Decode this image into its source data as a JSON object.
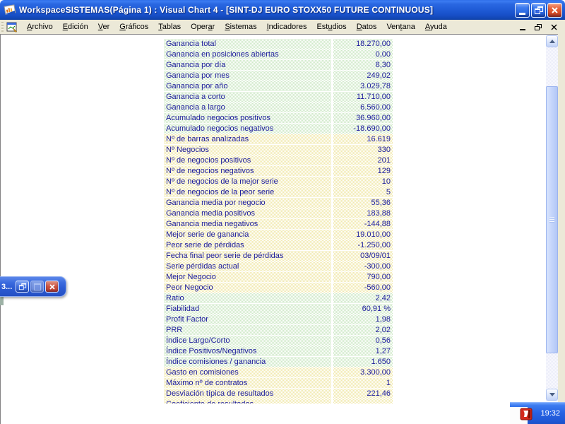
{
  "titlebar": {
    "title": "WorkspaceSISTEMAS(Página 1) : Visual Chart 4 - [SINT-DJ EURO STOXX50 FUTURE CONTINUOUS]",
    "controls": {
      "minimize": "minimize",
      "restore": "restore",
      "close": "close"
    }
  },
  "menubar": {
    "items": [
      {
        "label": "Archivo",
        "accel": 0
      },
      {
        "label": "Edición",
        "accel": 0
      },
      {
        "label": "Ver",
        "accel": 0
      },
      {
        "label": "Gráficos",
        "accel": 0
      },
      {
        "label": "Tablas",
        "accel": 0
      },
      {
        "label": "Operar",
        "accel": 4
      },
      {
        "label": "Sistemas",
        "accel": 0
      },
      {
        "label": "Indicadores",
        "accel": 0
      },
      {
        "label": "Estudios",
        "accel": 3
      },
      {
        "label": "Datos",
        "accel": 0
      },
      {
        "label": "Ventana",
        "accel": 3
      },
      {
        "label": "Ayuda",
        "accel": 0
      }
    ],
    "child_controls": {
      "minimize": "minimize",
      "restore": "restore",
      "close": "close"
    }
  },
  "stats": {
    "rows": [
      {
        "label": "Ganancia total",
        "value": "18.270,00",
        "color": "green"
      },
      {
        "label": "Ganancia en posiciones abiertas",
        "value": "0,00",
        "color": "green"
      },
      {
        "label": "Ganancia por día",
        "value": "8,30",
        "color": "green"
      },
      {
        "label": "Ganancia por mes",
        "value": "249,02",
        "color": "green"
      },
      {
        "label": "Ganancia por año",
        "value": "3.029,78",
        "color": "green"
      },
      {
        "label": "Ganancia a corto",
        "value": "11.710,00",
        "color": "green"
      },
      {
        "label": "Ganancia a largo",
        "value": "6.560,00",
        "color": "green"
      },
      {
        "label": "Acumulado negocios positivos",
        "value": "36.960,00",
        "color": "green"
      },
      {
        "label": "Acumulado negocios negativos",
        "value": "-18.690,00",
        "color": "green"
      },
      {
        "label": "Nº de barras analizadas",
        "value": "16.619",
        "color": "yellow"
      },
      {
        "label": "Nº Negocios",
        "value": "330",
        "color": "yellow"
      },
      {
        "label": "Nº de negocios positivos",
        "value": "201",
        "color": "yellow"
      },
      {
        "label": "Nº de negocios negativos",
        "value": "129",
        "color": "yellow"
      },
      {
        "label": "Nº de negocios de la mejor serie",
        "value": "10",
        "color": "yellow"
      },
      {
        "label": "Nº de negocios de la peor serie",
        "value": "5",
        "color": "yellow"
      },
      {
        "label": "Ganancia media por negocio",
        "value": "55,36",
        "color": "yellow"
      },
      {
        "label": "Ganancia media positivos",
        "value": "183,88",
        "color": "yellow"
      },
      {
        "label": "Ganancia media negativos",
        "value": "-144,88",
        "color": "yellow"
      },
      {
        "label": "Mejor serie de ganancia",
        "value": "19.010,00",
        "color": "yellow"
      },
      {
        "label": "Peor serie de pérdidas",
        "value": "-1.250,00",
        "color": "yellow"
      },
      {
        "label": "Fecha final peor serie de pérdidas",
        "value": "03/09/01",
        "color": "yellow"
      },
      {
        "label": "Serie pérdidas actual",
        "value": "-300,00",
        "color": "yellow"
      },
      {
        "label": "Mejor Negocio",
        "value": "790,00",
        "color": "yellow"
      },
      {
        "label": "Peor Negocio",
        "value": "-560,00",
        "color": "yellow"
      },
      {
        "label": "Ratio",
        "value": "2,42",
        "color": "green"
      },
      {
        "label": "Fiabilidad",
        "value": "60,91 %",
        "color": "green"
      },
      {
        "label": "Profit Factor",
        "value": "1,98",
        "color": "green"
      },
      {
        "label": "PRR",
        "value": "2,02",
        "color": "green"
      },
      {
        "label": "Índice Largo/Corto",
        "value": "0,56",
        "color": "green"
      },
      {
        "label": "Índice Positivos/Negativos",
        "value": "1,27",
        "color": "green"
      },
      {
        "label": "Índice comisiones / ganancia",
        "value": "1.650",
        "color": "green"
      },
      {
        "label": "Gasto en comisiones",
        "value": "3.300,00",
        "color": "yellow"
      },
      {
        "label": "Máximo nº de contratos",
        "value": "1",
        "color": "yellow"
      },
      {
        "label": "Desviación típica de resultados",
        "value": "221,46",
        "color": "yellow"
      },
      {
        "label": "Coeficiente de resultados",
        "value": "",
        "color": "yellow"
      }
    ]
  },
  "minimized_window": {
    "title": "3..."
  },
  "tray": {
    "time": "19:32"
  },
  "icons": {
    "titlebar_app": "visual-chart-logo",
    "menubar_doc": "chart-document-icon",
    "tray_app": "visual-chart-tray-icon"
  },
  "colors": {
    "titlebar_blue": "#1f5bd6",
    "menubar_tan": "#ece9d8",
    "row_green": "#cfe9c8",
    "row_yellow": "#f1e9ae",
    "stat_text": "#1c1c9c",
    "close_red": "#dd4f28",
    "taskbar_blue": "#2763e4"
  }
}
